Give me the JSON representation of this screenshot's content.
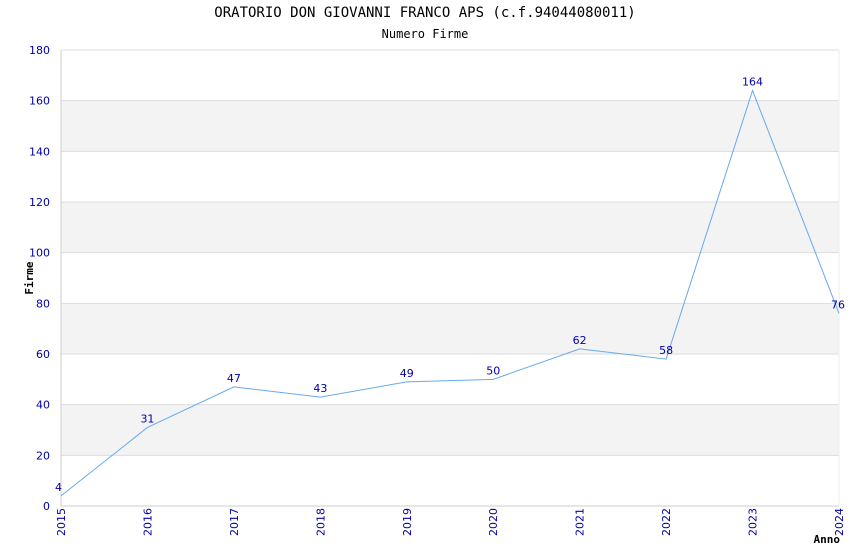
{
  "chart_data": {
    "type": "line",
    "title": "ORATORIO DON GIOVANNI FRANCO APS (c.f.94044080011)",
    "subtitle": "Numero Firme",
    "xlabel": "Anno",
    "ylabel": "Firme",
    "x": [
      "2015",
      "2016",
      "2017",
      "2018",
      "2019",
      "2020",
      "2021",
      "2022",
      "2023",
      "2024"
    ],
    "values": [
      4,
      31,
      47,
      43,
      49,
      50,
      62,
      58,
      164,
      76
    ],
    "ylim": [
      0,
      180
    ],
    "yticks": [
      0,
      20,
      40,
      60,
      80,
      100,
      120,
      140,
      160,
      180
    ],
    "grid": true,
    "line_color": "#66aaee",
    "label_color": "#0000aa",
    "band_color": "#f3f3f3"
  }
}
